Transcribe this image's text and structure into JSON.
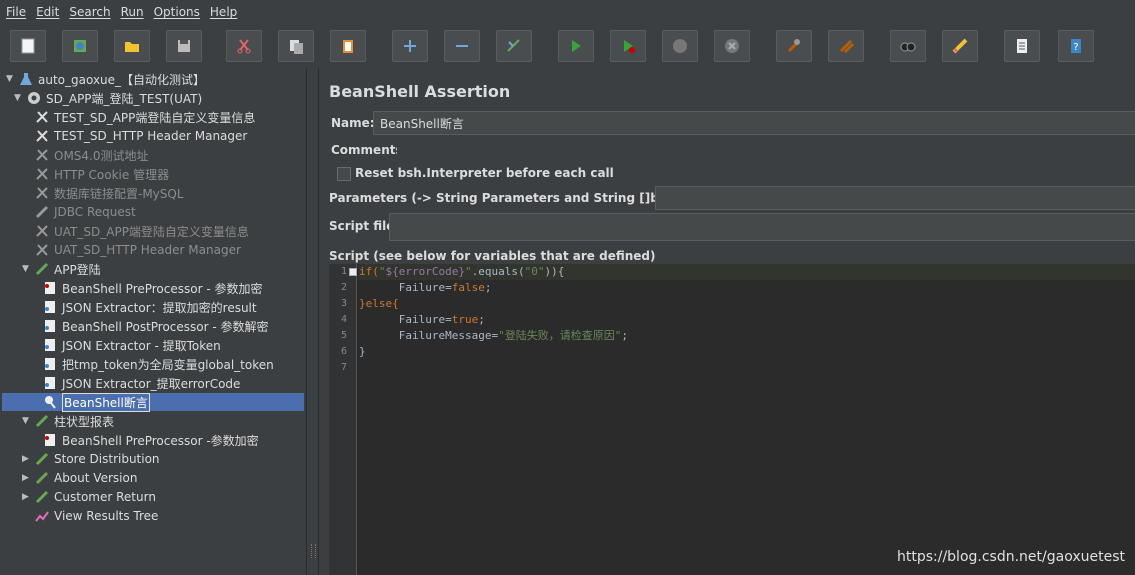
{
  "menubar": [
    "File",
    "Edit",
    "Search",
    "Run",
    "Options",
    "Help"
  ],
  "toolbar_icons": [
    "new-icon",
    "templates-icon",
    "open-icon",
    "save-icon",
    "cut-icon",
    "copy-icon",
    "paste-icon",
    "expand-icon",
    "collapse-icon",
    "toggle-icon",
    "start-icon",
    "start-no-pause-icon",
    "stop-icon",
    "shutdown-icon",
    "clear-icon",
    "clear-all-icon",
    "search-icon",
    "reset-search-icon",
    "function-helper-icon",
    "help-icon"
  ],
  "tree": {
    "root": "auto_gaoxue_【自动化测试】",
    "plan": "SD_APP端_登陆_TEST(UAT)",
    "items": [
      "TEST_SD_APP端登陆自定义变量信息",
      "TEST_SD_HTTP Header Manager",
      "OMS4.0测试地址",
      "HTTP Cookie 管理器",
      "数据库链接配置-MySQL",
      "JDBC Request",
      "UAT_SD_APP端登陆自定义变量信息",
      "UAT_SD_HTTP Header Manager"
    ],
    "app_group": "APP登陆",
    "app_children": [
      "BeanShell PreProcessor - 参数加密",
      "JSON Extractor：提取加密的result",
      "BeanShell PostProcessor - 参数解密",
      "JSON Extractor - 提取Token",
      "把tmp_token为全局变量global_token",
      "JSON Extractor_提取errorCode",
      "BeanShell断言"
    ],
    "chart_group": "柱状型报表",
    "chart_children": [
      "BeanShell PreProcessor -参数加密"
    ],
    "groups": [
      "Store Distribution",
      "About Version",
      "Customer Return"
    ],
    "listener": "View Results Tree"
  },
  "panel": {
    "title": "BeanShell Assertion",
    "name_label": "Name:",
    "name_value": "BeanShell断言",
    "comments_label": "Comments:",
    "reset_label": "Reset bsh.Interpreter before each call",
    "params_label": "Parameters (-> String Parameters and String []bsh.args)",
    "script_file_label": "Script file",
    "script_label": "Script (see below for variables that are defined)"
  },
  "script": {
    "line_numbers": [
      "1",
      "2",
      "3",
      "4",
      "5",
      "6",
      "7"
    ],
    "l1_if": "if(",
    "l1_q1": "\"",
    "l1_var": "${errorCode}",
    "l1_q2": "\"",
    "l1_eq": ".equals(",
    "l1_zero": "\"0\"",
    "l1_end": ")){",
    "l2_pre": "      Failure=",
    "l2_kw": "false",
    "l2_end": ";",
    "l3": "}else{",
    "l4_pre": "      Failure=",
    "l4_kw": "true",
    "l4_end": ";",
    "l5_pre": "      FailureMessage=",
    "l5_str": "\"登陆失败，请检查原因\"",
    "l5_end": ";",
    "l6": "}"
  },
  "watermark": "https://blog.csdn.net/gaoxuetest"
}
